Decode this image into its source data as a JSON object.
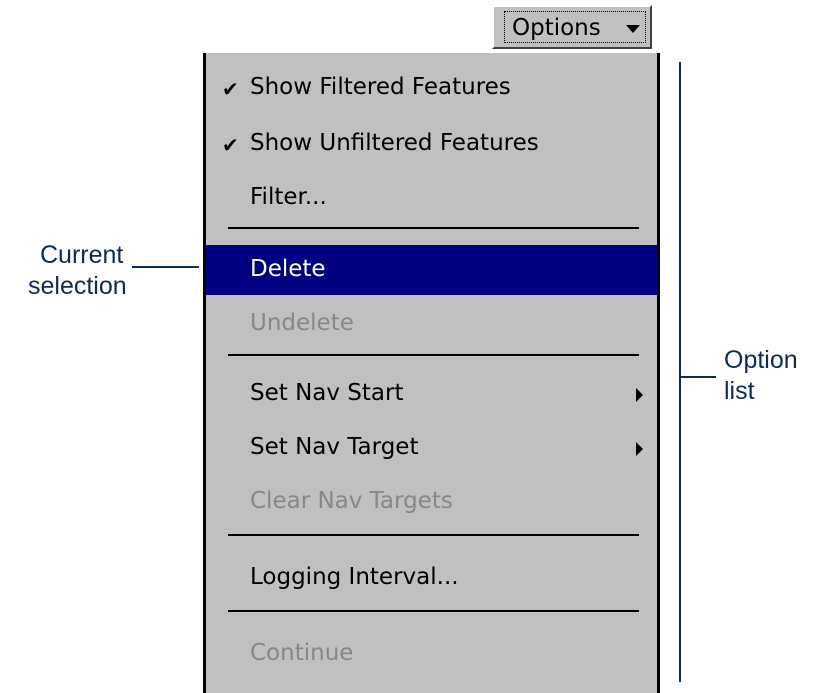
{
  "options_button": {
    "label": "Options"
  },
  "menu": {
    "items": [
      {
        "label": "Show Filtered Features",
        "checked": true,
        "enabled": true
      },
      {
        "label": "Show Unfiltered Features",
        "checked": true,
        "enabled": true
      },
      {
        "label": "Filter...",
        "checked": false,
        "enabled": true
      },
      {
        "label": "Delete",
        "checked": false,
        "enabled": true,
        "selected": true
      },
      {
        "label": "Undelete",
        "checked": false,
        "enabled": false
      },
      {
        "label": "Set Nav Start",
        "checked": false,
        "enabled": true,
        "submenu": true
      },
      {
        "label": "Set Nav Target",
        "checked": false,
        "enabled": true,
        "submenu": true
      },
      {
        "label": "Clear Nav Targets",
        "checked": false,
        "enabled": false
      },
      {
        "label": "Logging Interval...",
        "checked": false,
        "enabled": true
      },
      {
        "label": "Continue",
        "checked": false,
        "enabled": false
      }
    ],
    "check_glyph": "✔"
  },
  "annotations": {
    "current_selection": {
      "line1": "Current",
      "line2": "selection"
    },
    "option_list": {
      "line1": "Option",
      "line2": "list"
    }
  },
  "colors": {
    "menu_background": "#c0c0c0",
    "selection_highlight": "#000080",
    "disabled_text": "#878787",
    "annotation": "#0b2c57"
  }
}
